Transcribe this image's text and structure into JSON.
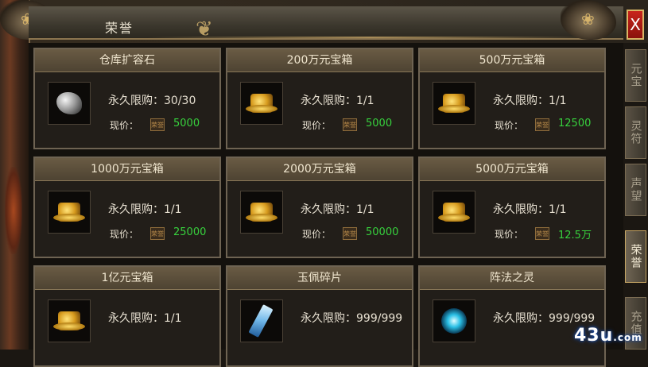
{
  "window": {
    "title": "荣誉",
    "close_label": "X"
  },
  "tabs": [
    {
      "label": "元宝",
      "active": false
    },
    {
      "label": "灵符",
      "active": false
    },
    {
      "label": "声望",
      "active": false
    },
    {
      "label": "荣誉",
      "active": true
    },
    {
      "label": "充值",
      "active": false
    }
  ],
  "items": [
    {
      "name": "仓库扩容石",
      "icon": "stone-icon",
      "limit": "永久限购：30/30",
      "price_label": "现价：",
      "currency": "荣誉",
      "price": "5000"
    },
    {
      "name": "200万元宝箱",
      "icon": "treasure-chest-icon",
      "limit": "永久限购：1/1",
      "price_label": "现价：",
      "currency": "荣誉",
      "price": "5000"
    },
    {
      "name": "500万元宝箱",
      "icon": "treasure-chest-icon",
      "limit": "永久限购：1/1",
      "price_label": "现价：",
      "currency": "荣誉",
      "price": "12500"
    },
    {
      "name": "1000万元宝箱",
      "icon": "treasure-chest-icon",
      "limit": "永久限购：1/1",
      "price_label": "现价：",
      "currency": "荣誉",
      "price": "25000"
    },
    {
      "name": "2000万元宝箱",
      "icon": "treasure-chest-icon",
      "limit": "永久限购：1/1",
      "price_label": "现价：",
      "currency": "荣誉",
      "price": "50000"
    },
    {
      "name": "5000万元宝箱",
      "icon": "treasure-chest-icon",
      "limit": "永久限购：1/1",
      "price_label": "现价：",
      "currency": "荣誉",
      "price": "12.5万"
    },
    {
      "name": "1亿元宝箱",
      "icon": "treasure-chest-icon",
      "limit": "永久限购：1/1",
      "price_label": "",
      "currency": "",
      "price": ""
    },
    {
      "name": "玉佩碎片",
      "icon": "jade-shard-icon",
      "limit": "永久限购：999/999",
      "price_label": "",
      "currency": "",
      "price": ""
    },
    {
      "name": "阵法之灵",
      "icon": "spirit-orb-icon",
      "limit": "永久限购：999/999",
      "price_label": "",
      "currency": "",
      "price": ""
    }
  ],
  "watermark": {
    "main": "43u",
    "suffix": ".com"
  },
  "colors": {
    "price": "#37d13d",
    "close": "#c8241c",
    "frame": "#6e6352"
  }
}
